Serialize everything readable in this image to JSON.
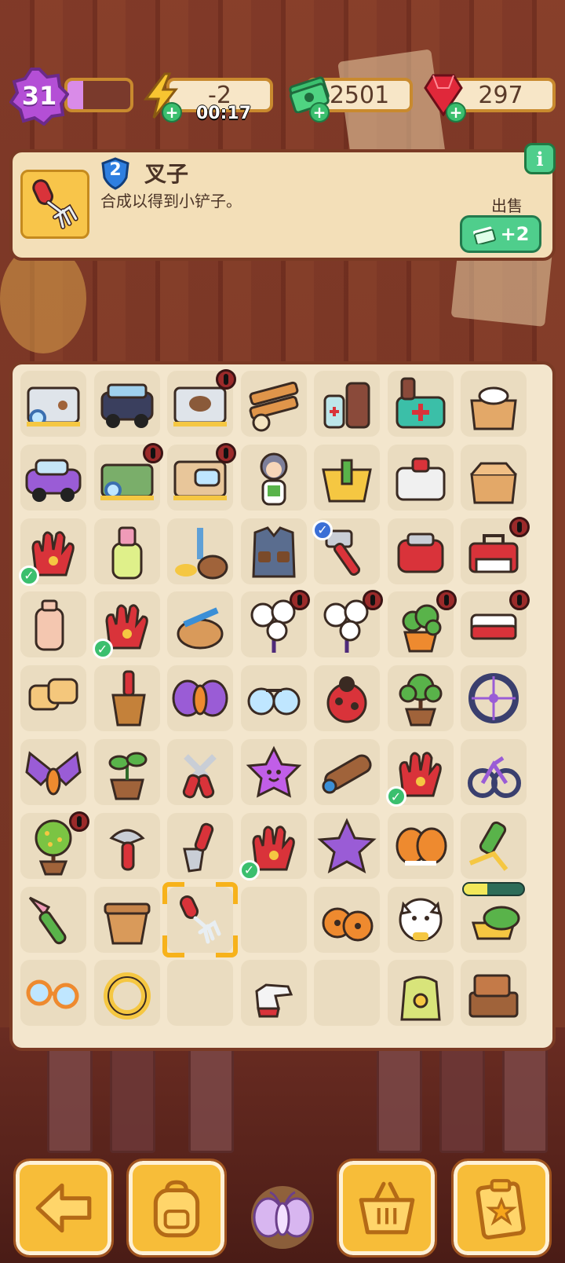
{
  "hud": {
    "level": "31",
    "xp_progress": 0.25,
    "energy_value": "-2",
    "energy_timer": "00:17",
    "cash_value": "2501",
    "gems_value": "297"
  },
  "info_panel": {
    "item_level": "2",
    "item_name": "叉子",
    "item_desc": "合成以得到小铲子。",
    "sell_label": "出售",
    "sell_reward": "+2",
    "info_icon_text": "i"
  },
  "board": {
    "cols": 7,
    "rows": 9,
    "items": [
      [
        "dig-site-paw-icon",
        "jeep-icon",
        "dig-site-locked-icon",
        "wood-planks-icon",
        "medicine-bottles-icon",
        "first-aid-kit-icon",
        "cardboard-box-icon"
      ],
      [
        "purple-car-icon",
        "fence-dig-site-icon",
        "bathtub-site-icon",
        "girl-character-icon",
        "yellow-basket-icon",
        "med-box-icon",
        "open-box-icon"
      ],
      [
        "red-gloves-icon",
        "spray-bottle-icon",
        "axe-stump-icon",
        "vest-icon",
        "hammer-icon",
        "red-backpack-icon",
        "toolbox-icon"
      ],
      [
        "lotion-bottle-icon",
        "red-gloves-icon",
        "hose-reel-icon",
        "dandelion-icon",
        "dandelion-icon",
        "potted-plant-icon",
        "red-toolbox-icon"
      ],
      [
        "sponge-icon",
        "brush-icon",
        "purple-moth-icon",
        "glasses-icon",
        "ladybug-icon",
        "bonsai-icon",
        "bike-wheel-icon"
      ],
      [
        "butterfly-icon",
        "sprout-pot-icon",
        "pruning-shears-icon",
        "star-jelly-icon",
        "telescope-icon",
        "red-gloves-icon",
        "bicycle-icon"
      ],
      [
        "flower-tree-icon",
        "hand-axe-icon",
        "trowel-icon",
        "red-gloves-icon",
        "purple-star-icon",
        "orange-beetles-icon",
        "spray-nozzle-icon"
      ],
      [
        "paintbrush-icon",
        "clay-pot-icon",
        "hand-fork-icon",
        "",
        "ladybug-pair-icon",
        "lucky-cat-icon",
        "sandwich-icon"
      ],
      [
        "goggles-icon",
        "yellow-ring-icon",
        "",
        "red-glove-single-icon",
        "",
        "seed-bag-icon",
        "wooden-crates-icon"
      ]
    ],
    "sandwich_progress": 0.4
  },
  "bottom_bar": {
    "buttons": [
      "back-arrow-icon",
      "backpack-icon",
      "moth-icon",
      "basket-icon",
      "clipboard-icon"
    ]
  },
  "colors": {
    "accent_gold": "#f7bd39",
    "panel_bg": "#f3e6cd",
    "panel_border": "#7a3a24",
    "green_button": "#4fce8c",
    "purple_level": "#b44fd6"
  }
}
